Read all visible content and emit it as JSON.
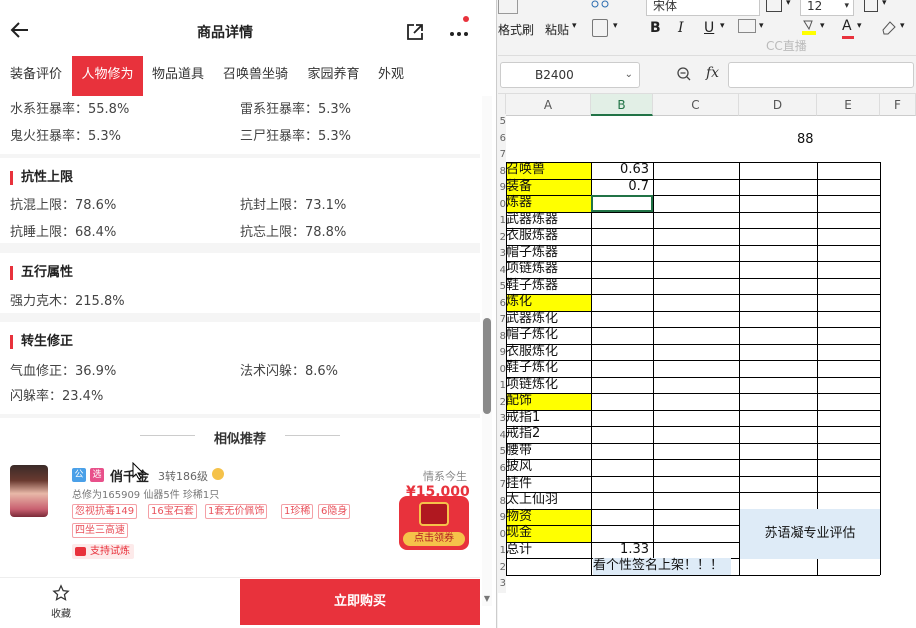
{
  "phone": {
    "title": "商品详情",
    "tabs": [
      {
        "label": "装备评价"
      },
      {
        "label": "人物修为"
      },
      {
        "label": "物品道具"
      },
      {
        "label": "召唤兽坐骑"
      },
      {
        "label": "家园养育"
      },
      {
        "label": "外观"
      }
    ],
    "active_tab": "人物修为",
    "crit_rows": [
      {
        "left": "水系狂暴率：55.8%",
        "right": "雷系狂暴率：5.3%"
      },
      {
        "left": "鬼火狂暴率：5.3%",
        "right": "三尸狂暴率：5.3%"
      }
    ],
    "resist": {
      "title": "抗性上限",
      "rows": [
        {
          "left": "抗混上限：78.6%",
          "right": "抗封上限：73.1%"
        },
        {
          "left": "抗睡上限：68.4%",
          "right": "抗忘上限：78.8%"
        }
      ]
    },
    "five_elements": {
      "title": "五行属性",
      "value": "强力克木：215.8%"
    },
    "rebirth": {
      "title": "转生修正",
      "rows": [
        {
          "left": "气血修正：36.9%",
          "right": "法术闪躲：8.6%"
        },
        {
          "left": "闪躲率：23.4%",
          "right": ""
        }
      ]
    },
    "recommend": {
      "title": "相似推荐",
      "badge1": "公",
      "badge2": "选",
      "name": "俏千金",
      "level": "3转186级",
      "stats": "总修为165909  仙器5件  珍稀1只",
      "tags": [
        "忽视抗毒149",
        "16宝石套",
        "1套无价佩饰",
        "1珍稀",
        "6隐身",
        "四坐三高速"
      ],
      "trial": "支持试炼",
      "seller_note": "情系今生",
      "price": "¥15,000",
      "coupon": "点击领券"
    },
    "fav_label": "收藏",
    "buy_label": "立即购买"
  },
  "sheet": {
    "ribbon": {
      "format_painter": "格式刷",
      "paste": "粘贴",
      "font_name": "宋体",
      "font_size": "12",
      "bold": "B",
      "italic": "I",
      "underline": "U",
      "fill_color": "A",
      "watermark": "CC直播"
    },
    "name_box": "B2400",
    "fx": "fx",
    "columns": [
      "A",
      "B",
      "C",
      "D",
      "E",
      "F"
    ],
    "selected_column": "B",
    "header_value": "88",
    "rows": [
      {
        "label": "召唤兽",
        "value": "0.63",
        "yellow": true
      },
      {
        "label": "装备",
        "value": "0.7",
        "yellow": true
      },
      {
        "label": "炼器",
        "value": "",
        "yellow": true
      },
      {
        "label": "武器炼器",
        "value": "",
        "yellow": false
      },
      {
        "label": "衣服炼器",
        "value": "",
        "yellow": false
      },
      {
        "label": "帽子炼器",
        "value": "",
        "yellow": false
      },
      {
        "label": "项链炼器",
        "value": "",
        "yellow": false
      },
      {
        "label": "鞋子炼器",
        "value": "",
        "yellow": false
      },
      {
        "label": "炼化",
        "value": "",
        "yellow": true
      },
      {
        "label": "武器炼化",
        "value": "",
        "yellow": false
      },
      {
        "label": "帽子炼化",
        "value": "",
        "yellow": false
      },
      {
        "label": "衣服炼化",
        "value": "",
        "yellow": false
      },
      {
        "label": "鞋子炼化",
        "value": "",
        "yellow": false
      },
      {
        "label": "项链炼化",
        "value": "",
        "yellow": false
      },
      {
        "label": "配饰",
        "value": "",
        "yellow": true
      },
      {
        "label": "戒指1",
        "value": "",
        "yellow": false
      },
      {
        "label": "戒指2",
        "value": "",
        "yellow": false
      },
      {
        "label": "腰带",
        "value": "",
        "yellow": false
      },
      {
        "label": "披风",
        "value": "",
        "yellow": false
      },
      {
        "label": "挂件",
        "value": "",
        "yellow": false
      },
      {
        "label": "太上仙羽",
        "value": "",
        "yellow": false
      },
      {
        "label": "物资",
        "value": "",
        "yellow": true
      },
      {
        "label": "现金",
        "value": "",
        "yellow": true
      },
      {
        "label": "总计",
        "value": "1.33",
        "yellow": false
      }
    ],
    "evaluator": "苏语凝专业评估",
    "footer_note": "看个性签名上架！！！",
    "row_numbers": [
      "5",
      "6",
      "7",
      "8",
      "9",
      "0",
      "1",
      "2",
      "3",
      "4",
      "5",
      "6",
      "7",
      "8",
      "9",
      "0",
      "1",
      "2",
      "3",
      "4",
      "5",
      "6",
      "7",
      "8",
      "9",
      "0",
      "1",
      "2",
      "3"
    ]
  }
}
